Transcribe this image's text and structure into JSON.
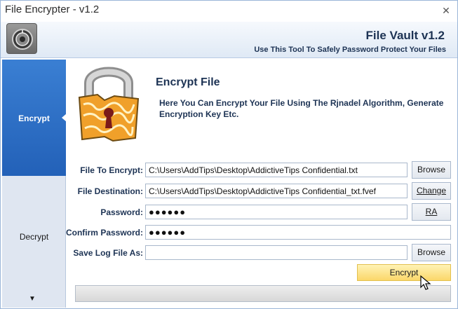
{
  "window": {
    "title": "File Encrypter - v1.2",
    "close_glyph": "✕"
  },
  "header": {
    "title": "File Vault v1.2",
    "subtitle": "Use This Tool To Safely Password Protect Your Files",
    "icon": "safe-dial-icon"
  },
  "sidebar": {
    "items": [
      {
        "label": "Encrypt",
        "selected": true
      },
      {
        "label": "Decrypt",
        "selected": false
      }
    ],
    "more_glyph": "▼"
  },
  "main": {
    "title": "Encrypt File",
    "description": "Here You Can Encrypt Your File Using The Rjnadel Algorithm, Generate Encryption Key Etc.",
    "image": "padlock-icon"
  },
  "form": {
    "file_to_encrypt": {
      "label": "File To Encrypt:",
      "value": "C:\\Users\\AddTips\\Desktop\\AddictiveTips Confidential.txt",
      "button": "Browse"
    },
    "file_destination": {
      "label": "File Destination:",
      "value": "C:\\Users\\AddTips\\Desktop\\AddictiveTips Confidential_txt.fvef",
      "button": "Change"
    },
    "password": {
      "label": "Password:",
      "value": "●●●●●●",
      "button": "RA"
    },
    "confirm_password": {
      "label": "Confirm Password:",
      "value": "●●●●●●"
    },
    "save_log": {
      "label": "Save Log File As:",
      "value": "",
      "button": "Browse"
    }
  },
  "actions": {
    "encrypt_label": "Encrypt"
  },
  "progress": {
    "value": 0
  },
  "colors": {
    "accent": "#2361b8",
    "title_text": "#1d3354",
    "encrypt_button": "#fbd76a",
    "sidebar_bg": "#dfe6f1"
  }
}
